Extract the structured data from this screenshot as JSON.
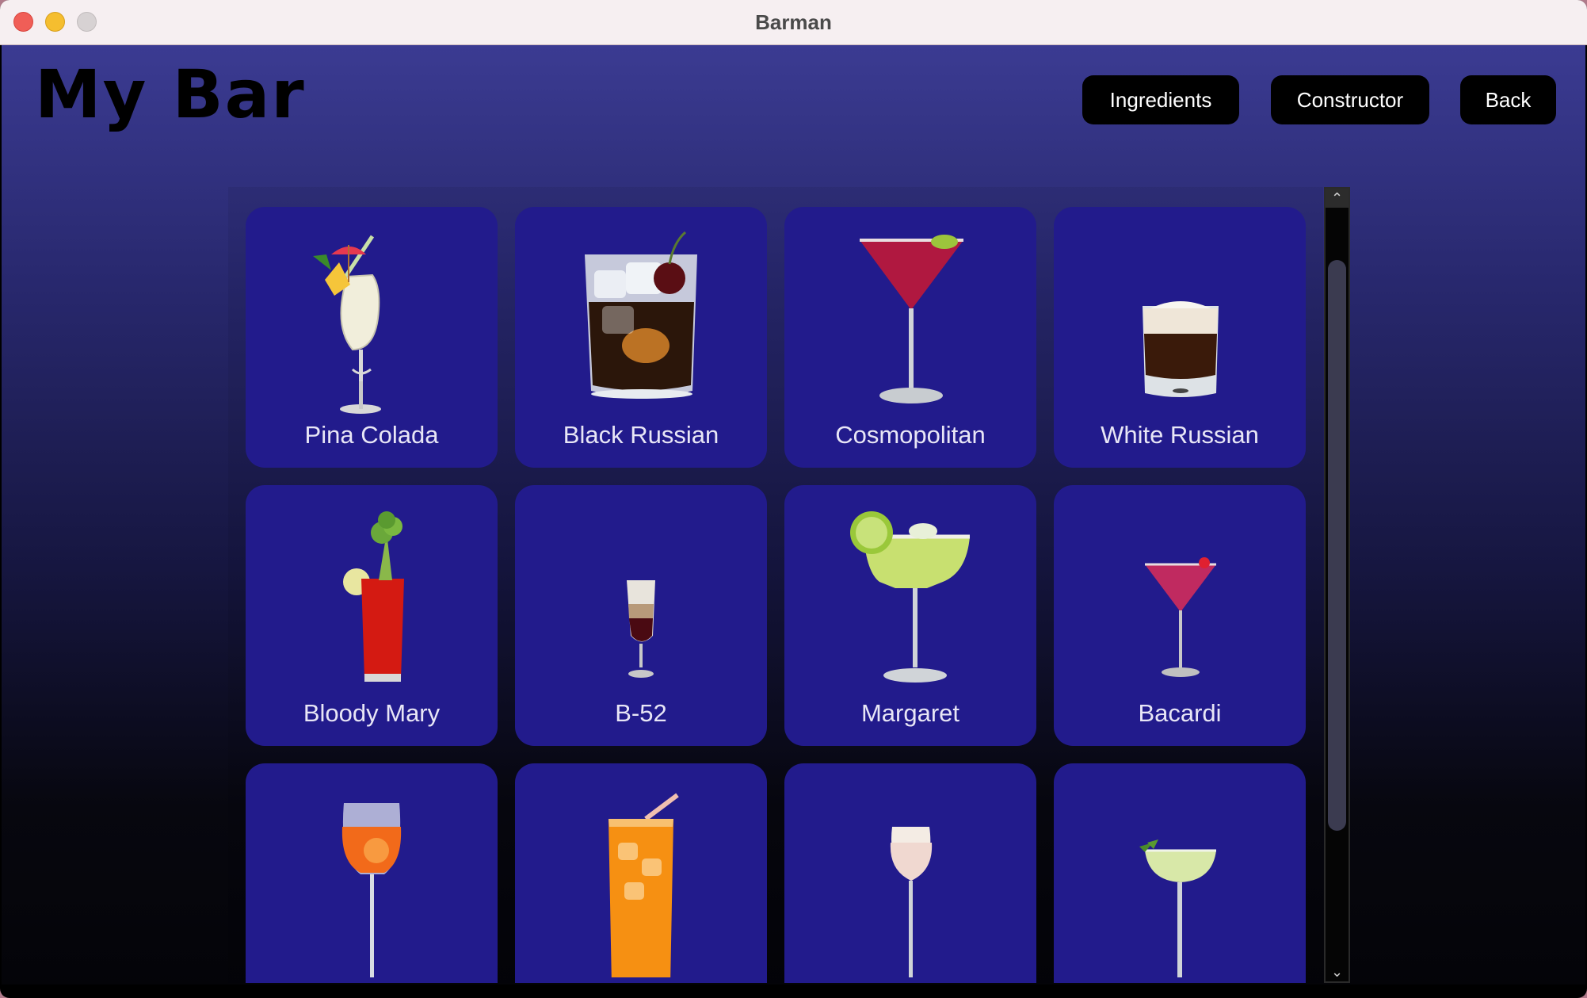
{
  "window": {
    "title": "Barman"
  },
  "header": {
    "title": "My Bar",
    "buttons": {
      "ingredients": "Ingredients",
      "constructor": "Constructor",
      "back": "Back"
    }
  },
  "cocktails": [
    {
      "name": "Pina Colada",
      "icon": "pina-colada-glass-icon"
    },
    {
      "name": "Black Russian",
      "icon": "black-russian-glass-icon"
    },
    {
      "name": "Cosmopolitan",
      "icon": "cosmopolitan-glass-icon"
    },
    {
      "name": "White Russian",
      "icon": "white-russian-glass-icon"
    },
    {
      "name": "Bloody Mary",
      "icon": "bloody-mary-glass-icon"
    },
    {
      "name": "B-52",
      "icon": "b52-glass-icon"
    },
    {
      "name": "Margaret",
      "icon": "margarita-glass-icon"
    },
    {
      "name": "Bacardi",
      "icon": "bacardi-glass-icon"
    },
    {
      "name": "",
      "icon": "spritz-glass-icon"
    },
    {
      "name": "",
      "icon": "orange-highball-glass-icon"
    },
    {
      "name": "",
      "icon": "white-wine-glass-icon"
    },
    {
      "name": "",
      "icon": "daiquiri-coupe-glass-icon"
    }
  ],
  "colors": {
    "card": "#221b8c",
    "button": "#000000",
    "title": "#000000"
  }
}
